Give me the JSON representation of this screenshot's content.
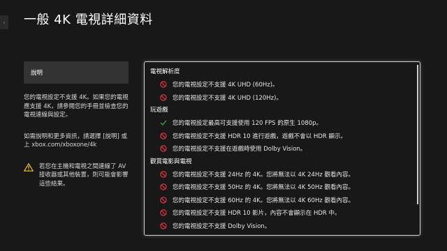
{
  "page": {
    "title": "一般 4K 電視詳細資料"
  },
  "colors": {
    "error": "#e0343e",
    "ok": "#3aa845",
    "warning": "#f0c43c"
  },
  "left": {
    "section_button": "說明",
    "paragraph1": "您的電視設定不支援 4K。如果您的電視應支援 4K，請參閱您的手冊並檢查您的電視連線與設定。",
    "paragraph2": "如需說明和更多資訊，請選擇 [說明] 或上 xbox.com/xboxone/4k",
    "warning": "若您在主機和電視之間連線了 AV 接收器或其他裝置，則可能會影響這些結果。"
  },
  "groups": [
    {
      "heading": "電視解析度",
      "items": [
        {
          "status": "error",
          "icon": "prohibited-icon",
          "text": "您的電視設定不支援 4K UHD (60Hz)。"
        },
        {
          "status": "error",
          "icon": "prohibited-icon",
          "text": "您的電視設定不支援 4K UHD (120Hz)。"
        }
      ]
    },
    {
      "heading": "玩遊戲",
      "items": [
        {
          "status": "ok",
          "icon": "checkmark-icon",
          "text": "您的電視設定最高可支援使用 120 FPS 的原生 1080p。"
        },
        {
          "status": "error",
          "icon": "prohibited-icon",
          "text": "您的電視設定不支援 HDR 10 進行遊戲，遊戲不會以 HDR 顯示。"
        },
        {
          "status": "error",
          "icon": "prohibited-icon",
          "text": "您的電視設定不支援在遊戲時使用 Dolby Vision。"
        }
      ]
    },
    {
      "heading": "觀賞電影與電視",
      "items": [
        {
          "status": "error",
          "icon": "prohibited-icon",
          "text": "您的電視設定不支援 24Hz 的 4K。您將無法以 4K 24Hz 觀看內容。"
        },
        {
          "status": "error",
          "icon": "prohibited-icon",
          "text": "您的電視設定不支援 50Hz 的 4K。您將無法以 4K 50Hz 觀看內容。"
        },
        {
          "status": "error",
          "icon": "prohibited-icon",
          "text": "您的電視設定不支援 60Hz 的 4K。您將無法以 4K 60Hz 觀看內容。"
        },
        {
          "status": "error",
          "icon": "prohibited-icon",
          "text": "您的電視設定不支援 HDR 10 影片，內容不會顯示在 HDR 中。"
        },
        {
          "status": "error",
          "icon": "prohibited-icon",
          "text": "您的電視設定不支援 Dolby Vision。"
        }
      ]
    }
  ]
}
